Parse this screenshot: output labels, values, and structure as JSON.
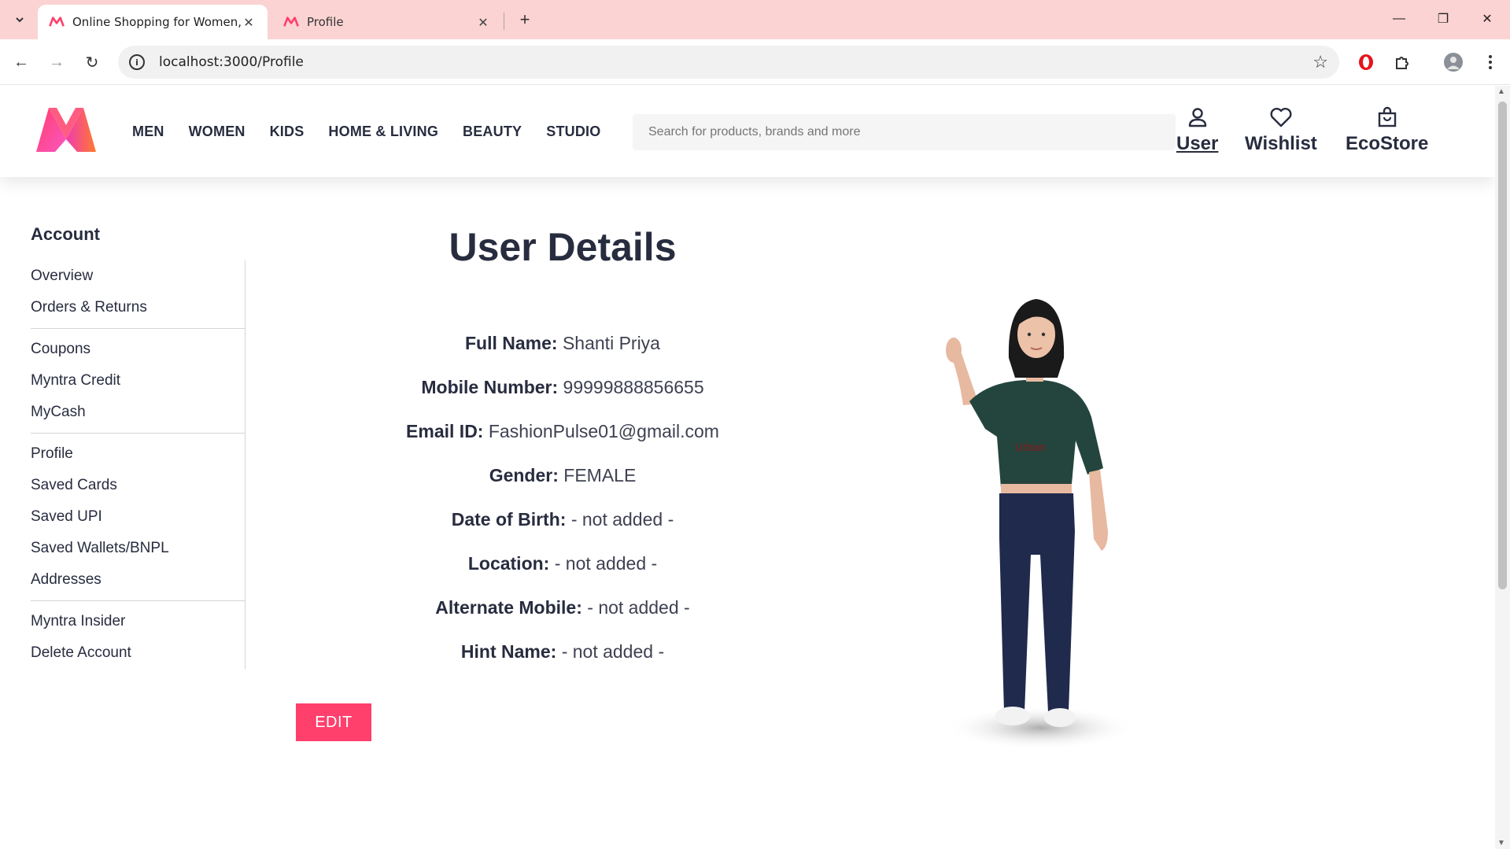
{
  "browser": {
    "tabs": [
      {
        "title": "Online Shopping for Women, M",
        "active": true
      },
      {
        "title": "Profile",
        "active": false
      }
    ],
    "url": "localhost:3000/Profile"
  },
  "header": {
    "nav": [
      "MEN",
      "WOMEN",
      "KIDS",
      "HOME & LIVING",
      "BEAUTY",
      "STUDIO"
    ],
    "search_placeholder": "Search for products, brands and more",
    "actions": {
      "user": "User",
      "wishlist": "Wishlist",
      "ecostore": "EcoStore"
    },
    "brand_color": "#ff3f6c"
  },
  "sidebar": {
    "heading": "Account",
    "groups": [
      [
        "Overview",
        "Orders & Returns"
      ],
      [
        "Coupons",
        "Myntra Credit",
        "MyCash"
      ],
      [
        "Profile",
        "Saved Cards",
        "Saved UPI",
        "Saved Wallets/BNPL",
        "Addresses"
      ],
      [
        "Myntra Insider",
        "Delete Account"
      ]
    ]
  },
  "details": {
    "title": "User Details",
    "rows": [
      {
        "label": "Full Name:",
        "value": "Shanti Priya"
      },
      {
        "label": "Mobile Number:",
        "value": "99999888856655"
      },
      {
        "label": "Email ID:",
        "value": "FashionPulse01@gmail.com"
      },
      {
        "label": "Gender:",
        "value": "FEMALE"
      },
      {
        "label": "Date of Birth:",
        "value": "- not added -"
      },
      {
        "label": "Location:",
        "value": "- not added -"
      },
      {
        "label": "Alternate Mobile:",
        "value": "- not added -"
      },
      {
        "label": "Hint Name:",
        "value": "- not added -"
      }
    ],
    "edit_label": "EDIT"
  }
}
